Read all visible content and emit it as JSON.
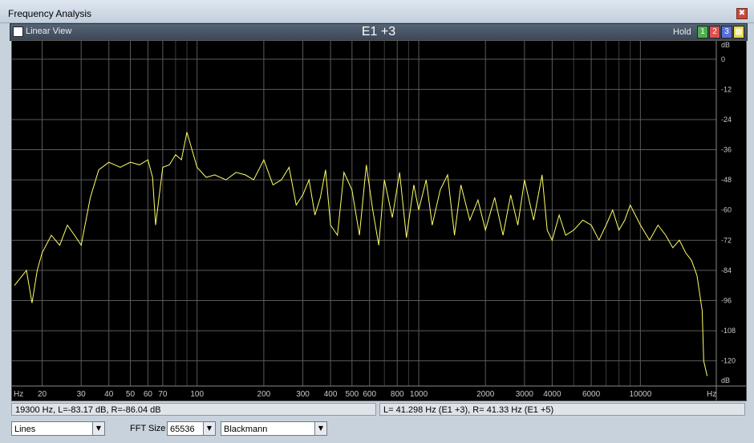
{
  "window": {
    "title": "Frequency Analysis",
    "close_glyph": "✖"
  },
  "toolbar": {
    "linear_view_label": "Linear View",
    "linear_view_checked": false,
    "graph_name": "E1 +3",
    "hold_label": "Hold",
    "hold_buttons": [
      {
        "label": "1",
        "color": "#4caf50"
      },
      {
        "label": "2",
        "color": "#d9534f"
      },
      {
        "label": "3",
        "color": "#5b6fd6"
      },
      {
        "label": "",
        "color": "#e6d84a"
      }
    ]
  },
  "colors": {
    "plot_bg": "#000000",
    "grid": "#5a5a5a",
    "trace": "#ffff66",
    "axis_text": "#c8c8c8"
  },
  "chart_data": {
    "type": "line",
    "x_scale": "log",
    "xlim": [
      15,
      22000
    ],
    "ylim": [
      -130,
      6
    ],
    "xlabel": "Hz",
    "ylabel": "dB",
    "x_ticks": [
      {
        "v": 20,
        "label": "20"
      },
      {
        "v": 30,
        "label": "30"
      },
      {
        "v": 40,
        "label": "40"
      },
      {
        "v": 50,
        "label": "50"
      },
      {
        "v": 60,
        "label": "60"
      },
      {
        "v": 70,
        "label": "70"
      },
      {
        "v": 100,
        "label": "100"
      },
      {
        "v": 200,
        "label": "200"
      },
      {
        "v": 300,
        "label": "300"
      },
      {
        "v": 400,
        "label": "400"
      },
      {
        "v": 500,
        "label": "500"
      },
      {
        "v": 600,
        "label": "600"
      },
      {
        "v": 800,
        "label": "800"
      },
      {
        "v": 1000,
        "label": "1000"
      },
      {
        "v": 2000,
        "label": "2000"
      },
      {
        "v": 3000,
        "label": "3000"
      },
      {
        "v": 4000,
        "label": "4000"
      },
      {
        "v": 6000,
        "label": "6000"
      },
      {
        "v": 10000,
        "label": "10000"
      }
    ],
    "x_minor": [
      80,
      90,
      700,
      900,
      5000,
      7000,
      8000,
      9000
    ],
    "y_ticks": [
      0,
      -12,
      -24,
      -36,
      -48,
      -60,
      -72,
      -84,
      -96,
      -108,
      -120
    ],
    "series": [
      {
        "x": [
          15,
          17,
          18,
          19,
          20,
          22,
          24,
          26,
          28,
          30,
          33,
          36,
          40,
          45,
          50,
          55,
          60,
          63,
          65,
          70,
          75,
          80,
          85,
          90,
          100,
          110,
          120,
          135,
          150,
          165,
          180,
          200,
          220,
          240,
          260,
          280,
          300,
          320,
          340,
          360,
          380,
          400,
          430,
          460,
          500,
          540,
          580,
          620,
          660,
          700,
          760,
          820,
          880,
          950,
          1000,
          1080,
          1150,
          1250,
          1350,
          1450,
          1550,
          1700,
          1850,
          2000,
          2200,
          2400,
          2600,
          2800,
          3000,
          3300,
          3600,
          3800,
          4000,
          4300,
          4600,
          5000,
          5500,
          6000,
          6500,
          7000,
          7500,
          8000,
          8500,
          9000,
          10000,
          11000,
          12000,
          13000,
          14000,
          15000,
          16000,
          17000,
          18000,
          19000,
          19300,
          20000
        ],
        "y": [
          -90,
          -84,
          -97,
          -84,
          -77,
          -70,
          -74,
          -66,
          -70,
          -74,
          -55,
          -44,
          -41,
          -43,
          -41,
          -42,
          -40,
          -47,
          -66,
          -43,
          -42,
          -38,
          -40,
          -29,
          -43,
          -47,
          -46,
          -48,
          -45,
          -46,
          -48,
          -40,
          -50,
          -48,
          -43,
          -58,
          -54,
          -48,
          -62,
          -55,
          -44,
          -66,
          -70,
          -45,
          -52,
          -70,
          -42,
          -60,
          -74,
          -48,
          -63,
          -45,
          -71,
          -50,
          -60,
          -48,
          -66,
          -52,
          -46,
          -70,
          -50,
          -64,
          -56,
          -68,
          -55,
          -70,
          -54,
          -66,
          -48,
          -64,
          -46,
          -68,
          -72,
          -62,
          -70,
          -68,
          -64,
          -66,
          -72,
          -66,
          -60,
          -68,
          -64,
          -58,
          -66,
          -72,
          -66,
          -70,
          -75,
          -72,
          -77,
          -80,
          -86,
          -100,
          -120,
          -126
        ]
      }
    ]
  },
  "status": {
    "left": "19300 Hz, L=-83.17 dB, R=-86.04 dB",
    "right": "L= 41.298 Hz (E1 +3), R=  41.33 Hz (E1 +5)"
  },
  "controls": {
    "mode_select": "Lines",
    "fft_size_label": "FFT Size",
    "fft_size_value": "65536",
    "window_select": "Blackmann"
  }
}
